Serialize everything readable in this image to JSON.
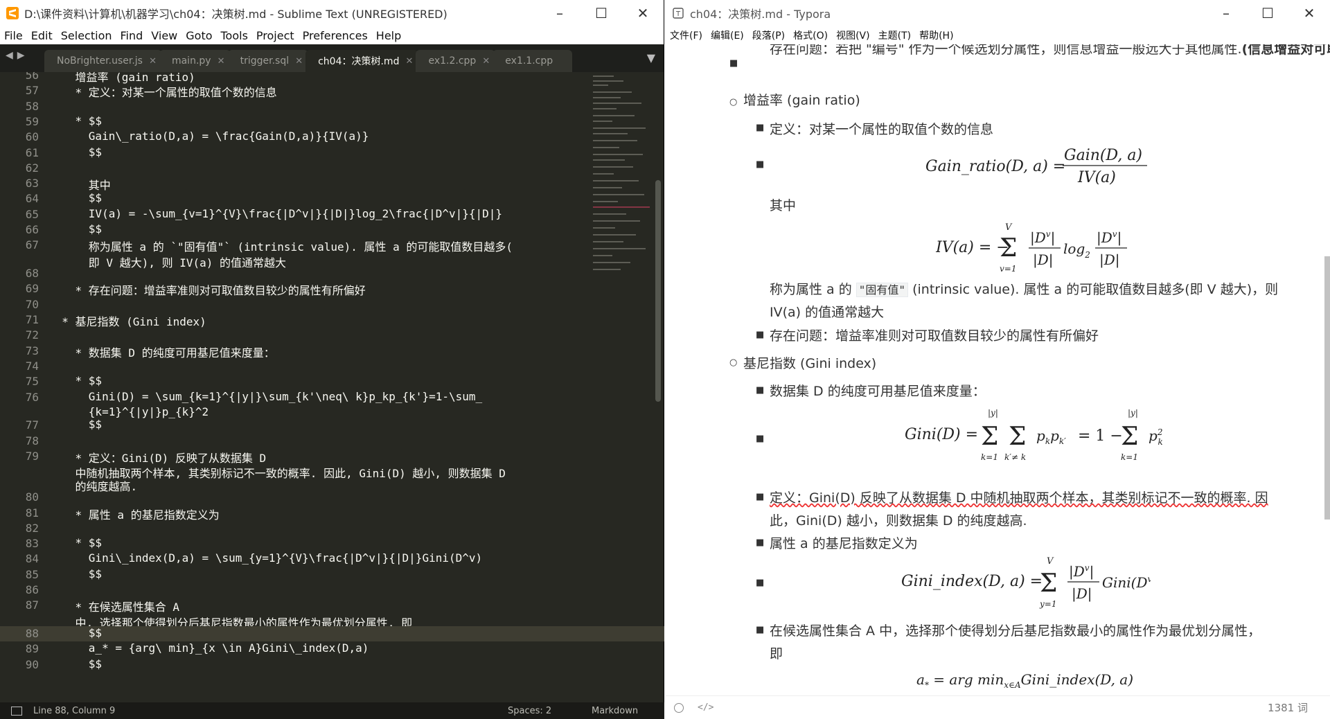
{
  "sublime": {
    "title": "D:\\课件资料\\计算机\\机器学习\\ch04：决策树.md - Sublime Text (UNREGISTERED)",
    "menu": [
      "File",
      "Edit",
      "Selection",
      "Find",
      "View",
      "Goto",
      "Tools",
      "Project",
      "Preferences",
      "Help"
    ],
    "tabs": [
      {
        "label": "NoBrighter.user.js"
      },
      {
        "label": "main.py"
      },
      {
        "label": "trigger.sql"
      },
      {
        "label": "ch04：决策树.md",
        "active": true
      },
      {
        "label": "ex1.2.cpp"
      },
      {
        "label": "ex1.1.cpp"
      }
    ],
    "lines": [
      {
        "n": "56",
        "t": "    增益率 (gain ratio)"
      },
      {
        "n": "57",
        "t": "    * 定义：对某一个属性的取值个数的信息"
      },
      {
        "n": "58",
        "t": ""
      },
      {
        "n": "59",
        "t": "    * $$"
      },
      {
        "n": "60",
        "t": "      Gain\\_ratio(D,a) = \\frac{Gain(D,a)}{IV(a)}"
      },
      {
        "n": "61",
        "t": "      $$"
      },
      {
        "n": "62",
        "t": ""
      },
      {
        "n": "63",
        "t": "      其中"
      },
      {
        "n": "64",
        "t": "      $$"
      },
      {
        "n": "65",
        "t": "      IV(a) = -\\sum_{v=1}^{V}\\frac{|D^v|}{|D|}log_2\\frac{|D^v|}{|D|}"
      },
      {
        "n": "66",
        "t": "      $$"
      },
      {
        "n": "67",
        "t": "      称为属性 a 的 `\"固有值\"` (intrinsic value). 属性 a 的可能取值数目越多("
      },
      {
        "n": "",
        "t": "      即 V 越大), 则 IV(a) 的值通常越大"
      },
      {
        "n": "68",
        "t": ""
      },
      {
        "n": "69",
        "t": "    * 存在问题：增益率准则对可取值数目较少的属性有所偏好"
      },
      {
        "n": "70",
        "t": ""
      },
      {
        "n": "71",
        "t": "  * 基尼指数 (Gini index)"
      },
      {
        "n": "72",
        "t": ""
      },
      {
        "n": "73",
        "t": "    * 数据集 D 的纯度可用基尼值来度量："
      },
      {
        "n": "74",
        "t": ""
      },
      {
        "n": "75",
        "t": "    * $$"
      },
      {
        "n": "76",
        "t": "      Gini(D) = \\sum_{k=1}^{|y|}\\sum_{k'\\neq\\ k}p_kp_{k'}=1-\\sum_"
      },
      {
        "n": "",
        "t": "      {k=1}^{|y|}p_{k}^2"
      },
      {
        "n": "77",
        "t": "      $$"
      },
      {
        "n": "78",
        "t": ""
      },
      {
        "n": "79",
        "t": "    * 定义：Gini(D) 反映了从数据集 D"
      },
      {
        "n": "",
        "t": "    中随机抽取两个样本, 其类别标记不一致的概率. 因此, Gini(D) 越小, 则数据集 D"
      },
      {
        "n": "",
        "t": "    的纯度越高."
      },
      {
        "n": "80",
        "t": ""
      },
      {
        "n": "81",
        "t": "    * 属性 a 的基尼指数定义为"
      },
      {
        "n": "82",
        "t": ""
      },
      {
        "n": "83",
        "t": "    * $$"
      },
      {
        "n": "84",
        "t": "      Gini\\_index(D,a) = \\sum_{y=1}^{V}\\frac{|D^v|}{|D|}Gini(D^v)"
      },
      {
        "n": "85",
        "t": "      $$"
      },
      {
        "n": "86",
        "t": ""
      },
      {
        "n": "87",
        "t": "    * 在候选属性集合 A"
      },
      {
        "n": "",
        "t": "    中, 选择那个使得划分后基尼指数最小的属性作为最优划分属性, 即"
      },
      {
        "n": "88",
        "t": "      $$"
      },
      {
        "n": "89",
        "t": "      a_* = {arg\\ min}_{x \\in A}Gini\\_index(D,a)"
      },
      {
        "n": "90",
        "t": "      $$"
      }
    ],
    "status": {
      "pos": "Line 88, Column 9",
      "spaces": "Spaces: 2",
      "syntax": "Markdown"
    }
  },
  "typora": {
    "title": "ch04：决策树.md - Typora",
    "menu": [
      "文件(F)",
      "编辑(E)",
      "段落(P)",
      "格式(O)",
      "视图(V)",
      "主题(T)",
      "帮助(H)"
    ],
    "top_text": "存在问题：若把 \"编号\" 作为一个候选划分属性，则信息增益一般远大于其他属性.",
    "top_bold": "(信息增益对可取值数目较多的属性有所偏好)",
    "gain_ratio": "增益率 (gain ratio)",
    "def1": "定义：对某一个属性的取值个数的信息",
    "formula_gain": "Gain_ratio(D, a) = Gain(D, a) / IV(a)",
    "qizhong": "其中",
    "formula_iv": "IV(a) = −Σ_{v=1}^{V} |D^v|/|D| log₂ |D^v|/|D|",
    "intrinsic_a": "称为属性 a 的",
    "intrinsic_code": "\"固有值\"",
    "intrinsic_b": "(intrinsic value). 属性 a 的可能取值数目越多(即 V 越大)，则",
    "intrinsic_c": "IV(a) 的值通常越大",
    "problem": "存在问题：增益率准则对可取值数目较少的属性有所偏好",
    "gini_title": "基尼指数 (Gini index)",
    "gini_measure": "数据集 D 的纯度可用基尼值来度量：",
    "formula_gini": "Gini(D) = Σ_{k=1}^{|y|} Σ_{k'≠k} p_k p_{k'} = 1 − Σ_{k=1}^{|y|} p_k²",
    "gini_def_a": "定义：Gini(D) 反映了从数据集 D 中随机抽取两个样本，其类别标记不一致的概率. 因",
    "gini_def_b": "此，Gini(D) 越小，则数据集 D 的纯度越高.",
    "gini_attr": "属性 a 的基尼指数定义为",
    "formula_gini_index": "Gini_index(D, a) = Σ_{y=1}^{V} |D^v|/|D| Gini(D^v)",
    "choose_a": "在候选属性集合 A 中，选择那个使得划分后基尼指数最小的属性作为最优划分属性，",
    "choose_b": "即",
    "formula_argmin": "a_* = arg min_{x∈A} Gini_index(D, a)",
    "word_count": "1381 词"
  }
}
